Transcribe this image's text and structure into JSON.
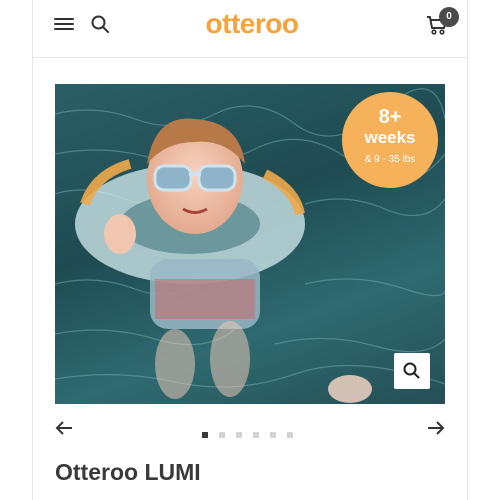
{
  "header": {
    "logo_text": "otteroo",
    "cart_count": "0",
    "brand_color": "#f5a33a"
  },
  "hero": {
    "image_description_icon": "baby-in-neck-float-photo",
    "badge_line1": "8+",
    "badge_line2": "weeks",
    "badge_line3": "& 9 - 35 lbs",
    "badge_color": "#f6b25a"
  },
  "carousel": {
    "slide_count": 6,
    "active_index": 0
  },
  "product": {
    "title": "Otteroo LUMI"
  },
  "icons": {
    "menu": "hamburger-menu-icon",
    "search": "search-icon",
    "cart": "cart-icon",
    "zoom": "zoom-icon",
    "prev": "arrow-left-icon",
    "next": "arrow-right-icon"
  }
}
